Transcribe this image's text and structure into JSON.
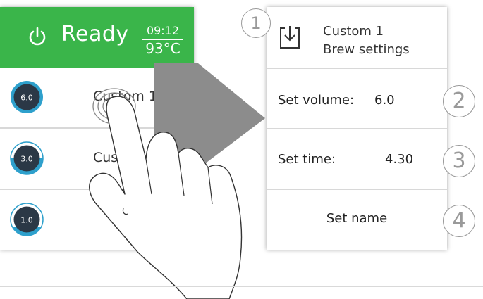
{
  "status": {
    "label": "Ready",
    "time": "09:12",
    "temperature": "93°C",
    "bar_color": "#3ab54a"
  },
  "presets": [
    {
      "volume": "6.0",
      "name": "Custom 1"
    },
    {
      "volume": "3.0",
      "name": "Custom"
    },
    {
      "volume": "1.0",
      "name": ""
    }
  ],
  "settings_menu": {
    "title_line1": "Custom 1",
    "title_line2": "Brew settings",
    "volume_label": "Set volume:",
    "volume_value": "6.0",
    "time_label": "Set time:",
    "time_value": "4.30",
    "name_label": "Set name"
  },
  "callouts": [
    "1",
    "2",
    "3",
    "4"
  ],
  "icons": [
    "power-icon",
    "cup-icon",
    "save-icon",
    "arrow-icon",
    "hand-icon",
    "touch-ripple-icon"
  ]
}
